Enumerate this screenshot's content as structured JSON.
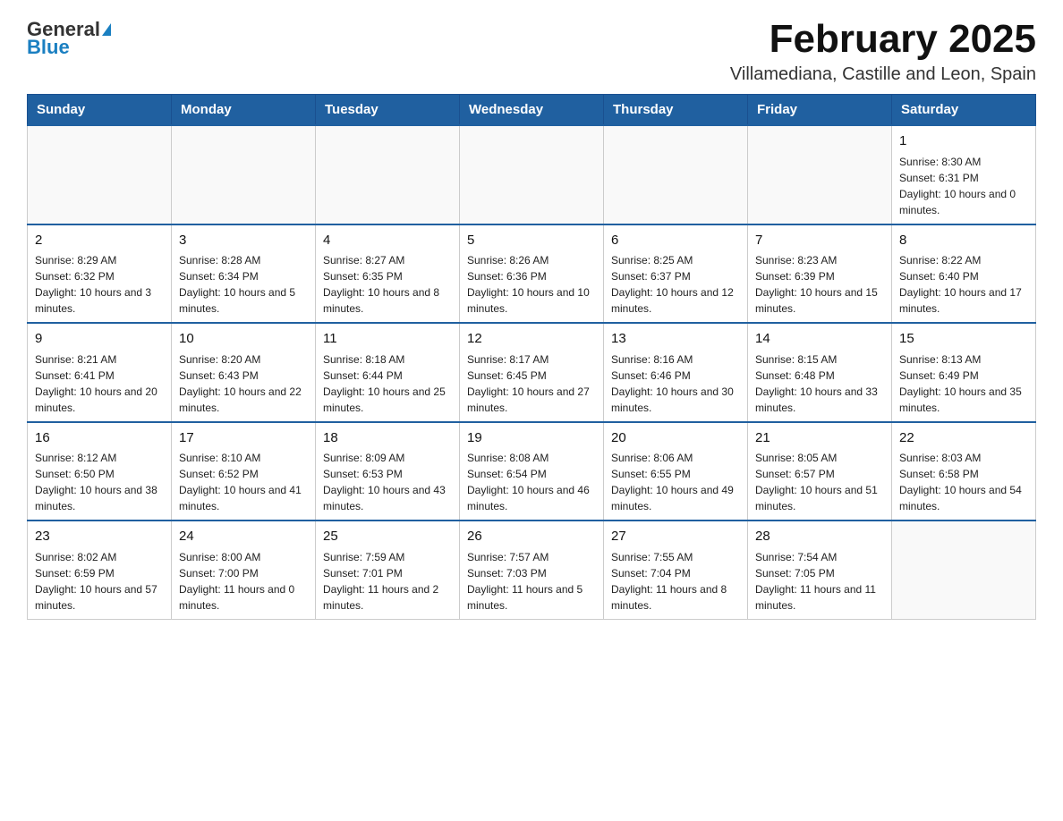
{
  "header": {
    "logo_general": "General",
    "logo_blue": "Blue",
    "title": "February 2025",
    "subtitle": "Villamediana, Castille and Leon, Spain"
  },
  "days_of_week": [
    "Sunday",
    "Monday",
    "Tuesday",
    "Wednesday",
    "Thursday",
    "Friday",
    "Saturday"
  ],
  "weeks": [
    [
      {
        "day": "",
        "info": ""
      },
      {
        "day": "",
        "info": ""
      },
      {
        "day": "",
        "info": ""
      },
      {
        "day": "",
        "info": ""
      },
      {
        "day": "",
        "info": ""
      },
      {
        "day": "",
        "info": ""
      },
      {
        "day": "1",
        "info": "Sunrise: 8:30 AM\nSunset: 6:31 PM\nDaylight: 10 hours and 0 minutes."
      }
    ],
    [
      {
        "day": "2",
        "info": "Sunrise: 8:29 AM\nSunset: 6:32 PM\nDaylight: 10 hours and 3 minutes."
      },
      {
        "day": "3",
        "info": "Sunrise: 8:28 AM\nSunset: 6:34 PM\nDaylight: 10 hours and 5 minutes."
      },
      {
        "day": "4",
        "info": "Sunrise: 8:27 AM\nSunset: 6:35 PM\nDaylight: 10 hours and 8 minutes."
      },
      {
        "day": "5",
        "info": "Sunrise: 8:26 AM\nSunset: 6:36 PM\nDaylight: 10 hours and 10 minutes."
      },
      {
        "day": "6",
        "info": "Sunrise: 8:25 AM\nSunset: 6:37 PM\nDaylight: 10 hours and 12 minutes."
      },
      {
        "day": "7",
        "info": "Sunrise: 8:23 AM\nSunset: 6:39 PM\nDaylight: 10 hours and 15 minutes."
      },
      {
        "day": "8",
        "info": "Sunrise: 8:22 AM\nSunset: 6:40 PM\nDaylight: 10 hours and 17 minutes."
      }
    ],
    [
      {
        "day": "9",
        "info": "Sunrise: 8:21 AM\nSunset: 6:41 PM\nDaylight: 10 hours and 20 minutes."
      },
      {
        "day": "10",
        "info": "Sunrise: 8:20 AM\nSunset: 6:43 PM\nDaylight: 10 hours and 22 minutes."
      },
      {
        "day": "11",
        "info": "Sunrise: 8:18 AM\nSunset: 6:44 PM\nDaylight: 10 hours and 25 minutes."
      },
      {
        "day": "12",
        "info": "Sunrise: 8:17 AM\nSunset: 6:45 PM\nDaylight: 10 hours and 27 minutes."
      },
      {
        "day": "13",
        "info": "Sunrise: 8:16 AM\nSunset: 6:46 PM\nDaylight: 10 hours and 30 minutes."
      },
      {
        "day": "14",
        "info": "Sunrise: 8:15 AM\nSunset: 6:48 PM\nDaylight: 10 hours and 33 minutes."
      },
      {
        "day": "15",
        "info": "Sunrise: 8:13 AM\nSunset: 6:49 PM\nDaylight: 10 hours and 35 minutes."
      }
    ],
    [
      {
        "day": "16",
        "info": "Sunrise: 8:12 AM\nSunset: 6:50 PM\nDaylight: 10 hours and 38 minutes."
      },
      {
        "day": "17",
        "info": "Sunrise: 8:10 AM\nSunset: 6:52 PM\nDaylight: 10 hours and 41 minutes."
      },
      {
        "day": "18",
        "info": "Sunrise: 8:09 AM\nSunset: 6:53 PM\nDaylight: 10 hours and 43 minutes."
      },
      {
        "day": "19",
        "info": "Sunrise: 8:08 AM\nSunset: 6:54 PM\nDaylight: 10 hours and 46 minutes."
      },
      {
        "day": "20",
        "info": "Sunrise: 8:06 AM\nSunset: 6:55 PM\nDaylight: 10 hours and 49 minutes."
      },
      {
        "day": "21",
        "info": "Sunrise: 8:05 AM\nSunset: 6:57 PM\nDaylight: 10 hours and 51 minutes."
      },
      {
        "day": "22",
        "info": "Sunrise: 8:03 AM\nSunset: 6:58 PM\nDaylight: 10 hours and 54 minutes."
      }
    ],
    [
      {
        "day": "23",
        "info": "Sunrise: 8:02 AM\nSunset: 6:59 PM\nDaylight: 10 hours and 57 minutes."
      },
      {
        "day": "24",
        "info": "Sunrise: 8:00 AM\nSunset: 7:00 PM\nDaylight: 11 hours and 0 minutes."
      },
      {
        "day": "25",
        "info": "Sunrise: 7:59 AM\nSunset: 7:01 PM\nDaylight: 11 hours and 2 minutes."
      },
      {
        "day": "26",
        "info": "Sunrise: 7:57 AM\nSunset: 7:03 PM\nDaylight: 11 hours and 5 minutes."
      },
      {
        "day": "27",
        "info": "Sunrise: 7:55 AM\nSunset: 7:04 PM\nDaylight: 11 hours and 8 minutes."
      },
      {
        "day": "28",
        "info": "Sunrise: 7:54 AM\nSunset: 7:05 PM\nDaylight: 11 hours and 11 minutes."
      },
      {
        "day": "",
        "info": ""
      }
    ]
  ]
}
